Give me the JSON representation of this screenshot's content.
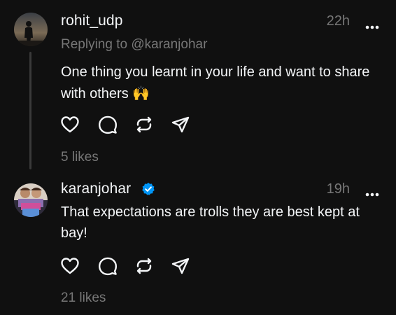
{
  "posts": [
    {
      "username": "rohit_udp",
      "time": "22h",
      "replying_to": "Replying to @karanjohar",
      "text": "One thing you learnt in your life and want to share with others",
      "emoji": "🙌",
      "likes": "5 likes",
      "verified": false
    },
    {
      "username": "karanjohar",
      "time": "19h",
      "text": "That expectations are trolls they are best kept at bay!",
      "likes": "21 likes",
      "verified": true
    }
  ],
  "icons": {
    "actions": [
      "heart-icon",
      "comment-icon",
      "repost-icon",
      "share-icon"
    ],
    "more": "more-options-icon",
    "verified": "verified-badge-icon"
  },
  "colors": {
    "background": "#101010",
    "text_primary": "#f3f5f7",
    "text_secondary": "#777777",
    "verified_blue": "#0095f6"
  }
}
